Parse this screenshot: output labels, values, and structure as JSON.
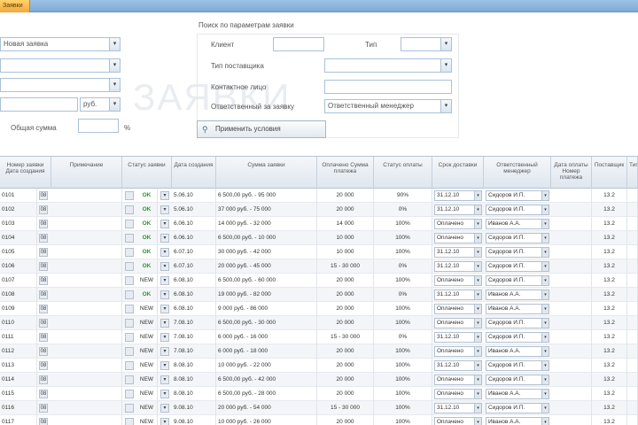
{
  "tab": {
    "label": "Заявки"
  },
  "form": {
    "left_top_caption": "",
    "left_fields": [
      {
        "value": "Новая заявка"
      },
      {
        "value": ""
      },
      {
        "value": ""
      },
      {
        "value": "руб."
      }
    ],
    "total_caption": "Общая сумма",
    "total_value": "",
    "total_unit": "%",
    "group_caption": "Поиск по параметрам заявки",
    "group_fields": [
      {
        "caption": "Клиент",
        "value": ""
      },
      {
        "caption": "Тип поставщика",
        "value": ""
      },
      {
        "caption": "Контактное лицо",
        "value": ""
      },
      {
        "caption": "Ответственный за заявку",
        "value": "Ответственный менеджер"
      }
    ],
    "right_small_caption": "Тип",
    "right_small_value": "",
    "search_button_label": "Применить условия",
    "watermark": "ЗАЯВКИ"
  },
  "grid": {
    "headers": [
      "Номер заявки Дата создания",
      "Примечание",
      "Статус заявки",
      "Дата создания",
      "Сумма заявки",
      "Оплачено Сумма платежа",
      "Статус оплаты",
      "Срок доставки",
      "Ответственный менеджер",
      "Дата оплаты Номер платежа",
      "Поставщик",
      "Тип"
    ],
    "rows": [
      {
        "id": "0101",
        "n": "08",
        "status": "OK",
        "date": "5.06.10",
        "amount": "6 500,00 руб. - 95 000",
        "paid": "20 000",
        "pay": "90%",
        "term": "31.12.10",
        "manager": "Сидоров И.П.",
        "d2": "13.2"
      },
      {
        "id": "0102",
        "n": "08",
        "status": "OK",
        "date": "5.06.10",
        "amount": "37 000 руб. - 75 000",
        "paid": "20 000",
        "pay": "0%",
        "term": "31.12.10",
        "manager": "Сидоров И.П.",
        "d2": "13.2"
      },
      {
        "id": "0103",
        "n": "08",
        "status": "OK",
        "date": "6.06.10",
        "amount": "14 000 руб. - 32 000",
        "paid": "14 000",
        "pay": "100%",
        "term": "Оплачено",
        "manager": "Иванов А.А.",
        "d2": "13.2"
      },
      {
        "id": "0104",
        "n": "08",
        "status": "OK",
        "date": "6.06.10",
        "amount": "6 500,00 руб. - 10 000",
        "paid": "10 000",
        "pay": "100%",
        "term": "Оплачено",
        "manager": "Сидоров И.П.",
        "d2": "13.2"
      },
      {
        "id": "0105",
        "n": "08",
        "status": "OK",
        "date": "6.07.10",
        "amount": "30 000 руб. - 42 000",
        "paid": "10 000",
        "pay": "100%",
        "term": "31.12.10",
        "manager": "Сидоров И.П.",
        "d2": "13.2"
      },
      {
        "id": "0106",
        "n": "08",
        "status": "OK",
        "date": "6.07.10",
        "amount": "20 000 руб. - 45 000",
        "paid": "15 - 30 000",
        "pay": "0%",
        "term": "31.12.10",
        "manager": "Сидоров И.П.",
        "d2": "13.2"
      },
      {
        "id": "0107",
        "n": "08",
        "status": "NEW",
        "date": "6.08.10",
        "amount": "6 500,00 руб. - 60 000",
        "paid": "20 000",
        "pay": "100%",
        "term": "Оплачено",
        "manager": "Сидоров И.П.",
        "d2": "13.2"
      },
      {
        "id": "0108",
        "n": "08",
        "status": "OK",
        "date": "6.08.10",
        "amount": "19 000 руб. - 82 000",
        "paid": "20 000",
        "pay": "0%",
        "term": "31.12.10",
        "manager": "Иванов А.А.",
        "d2": "13.2"
      },
      {
        "id": "0109",
        "n": "08",
        "status": "NEW",
        "date": "6.08.10",
        "amount": "9 000 руб. - 86 000",
        "paid": "20 000",
        "pay": "100%",
        "term": "Оплачено",
        "manager": "Иванов А.А.",
        "d2": "13.2"
      },
      {
        "id": "0110",
        "n": "08",
        "status": "NEW",
        "date": "7.08.10",
        "amount": "6 500,00 руб. - 30 000",
        "paid": "20 000",
        "pay": "100%",
        "term": "Оплачено",
        "manager": "Сидоров И.П.",
        "d2": "13.2"
      },
      {
        "id": "0111",
        "n": "08",
        "status": "NEW",
        "date": "7.08.10",
        "amount": "6 000 руб. - 16 000",
        "paid": "15 - 30 000",
        "pay": "0%",
        "term": "31.12.10",
        "manager": "Сидоров И.П.",
        "d2": "13.2"
      },
      {
        "id": "0112",
        "n": "08",
        "status": "NEW",
        "date": "7.08.10",
        "amount": "6 000 руб. - 18 000",
        "paid": "20 000",
        "pay": "100%",
        "term": "Оплачено",
        "manager": "Иванов А.А.",
        "d2": "13.2"
      },
      {
        "id": "0113",
        "n": "08",
        "status": "NEW",
        "date": "8.08.10",
        "amount": "10 000 руб. - 22 000",
        "paid": "20 000",
        "pay": "100%",
        "term": "31.12.10",
        "manager": "Сидоров И.П.",
        "d2": "13.2"
      },
      {
        "id": "0114",
        "n": "08",
        "status": "NEW",
        "date": "8.08.10",
        "amount": "6 500,00 руб. - 42 000",
        "paid": "20 000",
        "pay": "100%",
        "term": "Оплачено",
        "manager": "Сидоров И.П.",
        "d2": "13.2"
      },
      {
        "id": "0115",
        "n": "08",
        "status": "NEW",
        "date": "8.08.10",
        "amount": "6 500,00 руб. - 28 000",
        "paid": "20 000",
        "pay": "100%",
        "term": "Оплачено",
        "manager": "Иванов А.А.",
        "d2": "13.2"
      },
      {
        "id": "0116",
        "n": "08",
        "status": "NEW",
        "date": "9.08.10",
        "amount": "20 000 руб. - 54 000",
        "paid": "15 - 30 000",
        "pay": "100%",
        "term": "31.12.10",
        "manager": "Сидоров И.П.",
        "d2": "13.2"
      },
      {
        "id": "0117",
        "n": "08",
        "status": "NEW",
        "date": "9.08.10",
        "amount": "10 000 руб. - 26 000",
        "paid": "20 000",
        "pay": "100%",
        "term": "Оплачено",
        "manager": "Иванов А.А.",
        "d2": "13.2"
      }
    ]
  }
}
